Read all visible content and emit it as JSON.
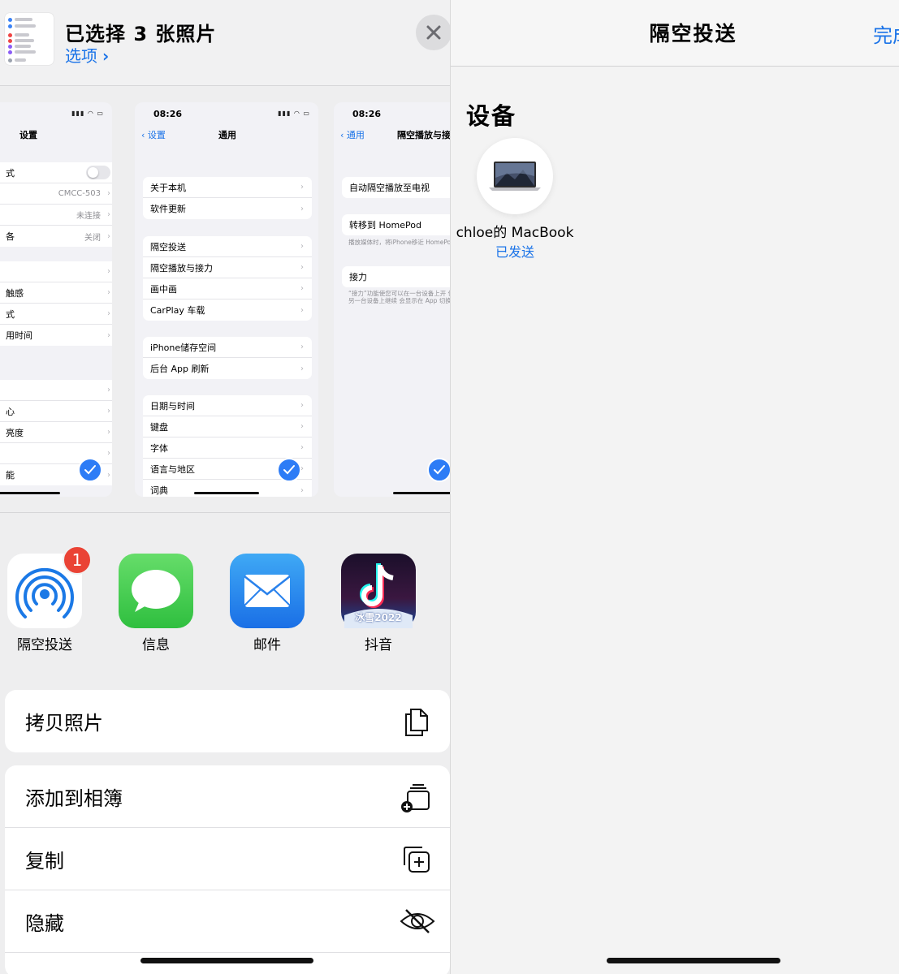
{
  "share_sheet": {
    "title": "已选择 3 张照片",
    "options_label": "选项",
    "close_icon": "close-icon",
    "previews": [
      {
        "nav_title": "设置",
        "rows_group1": [
          {
            "label": "式",
            "value": ""
          },
          {
            "label": "",
            "value": "CMCC-503"
          },
          {
            "label": "",
            "value": "未连接"
          },
          {
            "label": "各",
            "value": "关闭"
          }
        ],
        "rows_group2": [
          {
            "label": "",
            "value": ""
          },
          {
            "label": "触感",
            "value": ""
          },
          {
            "label": "式",
            "value": ""
          },
          {
            "label": "用时间",
            "value": ""
          }
        ],
        "rows_group3": [
          {
            "label": "",
            "value": ""
          },
          {
            "label": "心",
            "value": ""
          },
          {
            "label": "亮度",
            "value": ""
          },
          {
            "label": "",
            "value": ""
          },
          {
            "label": "能",
            "value": ""
          }
        ]
      },
      {
        "time": "08:26",
        "back_label": "设置",
        "nav_title": "通用",
        "group1": [
          "关于本机",
          "软件更新"
        ],
        "group2": [
          "隔空投送",
          "隔空播放与接力",
          "画中画",
          "CarPlay 车载"
        ],
        "group3": [
          "iPhone储存空间",
          "后台 App 刷新"
        ],
        "group4": [
          "日期与时间",
          "键盘",
          "字体",
          "语言与地区",
          "词典"
        ]
      },
      {
        "time": "08:26",
        "back_label": "通用",
        "nav_title": "隔空播放与接力",
        "row1": "自动隔空播放至电视",
        "row2": "转移到 HomePod",
        "note2": "播放媒体时，将iPhone移近 HomePod 转移播放。",
        "row3": "接力",
        "note3": "“接力”功能使您可以在一台设备上开 使用iCloud帐户的另一台设备上继续 会显示在 App 切换器和Mac程序坞中"
      }
    ],
    "apps": [
      {
        "label": "隔空投送",
        "icon": "airdrop-icon",
        "badge": "1"
      },
      {
        "label": "信息",
        "icon": "messages-icon"
      },
      {
        "label": "邮件",
        "icon": "mail-icon"
      },
      {
        "label": "抖音",
        "icon": "douyin-icon",
        "icon_text": "冰雪2022"
      }
    ],
    "actions_group1": [
      {
        "label": "拷贝照片",
        "icon": "copy-photo-icon"
      }
    ],
    "actions_group2": [
      {
        "label": "添加到相簿",
        "icon": "add-to-album-icon"
      },
      {
        "label": "复制",
        "icon": "duplicate-icon"
      },
      {
        "label": "隐藏",
        "icon": "hide-eye-icon"
      }
    ]
  },
  "airdrop": {
    "title": "隔空投送",
    "done_label": "完成",
    "section_title": "设备",
    "device": {
      "name": "chloe的 MacBook",
      "status": "已发送",
      "icon": "macbook-icon"
    }
  },
  "colors": {
    "accent": "#1a73e8",
    "badge": "#ea4335",
    "check": "#2d7cf6"
  }
}
